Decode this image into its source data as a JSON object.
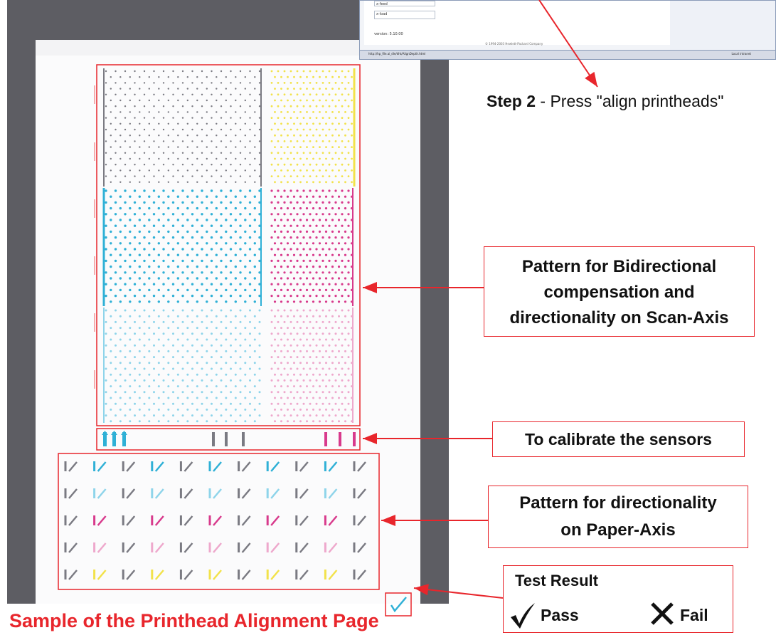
{
  "embedded_screenshot": {
    "fields": [
      "x-feed",
      "x-load"
    ],
    "version": "version: 5.10.00",
    "copyright": "© 1994-2003 Hewlett-Packard Company",
    "url": "http://hp_file.ai_dle/dht/AlignDepth.html",
    "zone": "Local intranet"
  },
  "step2": {
    "bold": "Step 2",
    "rest": " - Press \"align printheads\""
  },
  "callouts": {
    "bidirectional": [
      "Pattern for Bidirectional",
      "compensation and",
      "directionality on Scan-Axis"
    ],
    "sensors": "To calibrate the sensors",
    "paper_axis": [
      "Pattern for directionality",
      "on Paper-Axis"
    ],
    "test_result_title": "Test Result",
    "pass_label": "Pass",
    "fail_label": "Fail"
  },
  "caption": "Sample of the Printhead Alignment Page",
  "colors": {
    "callout_red": "#e8262c",
    "frame_gray": "#5d5d63",
    "ink_black": "#7a7a82",
    "ink_yellow": "#f2e24a",
    "ink_cyan": "#2fb0d6",
    "ink_light_cyan": "#8ed4ea",
    "ink_magenta": "#d83a8c",
    "ink_light_magenta": "#eea8cc"
  }
}
